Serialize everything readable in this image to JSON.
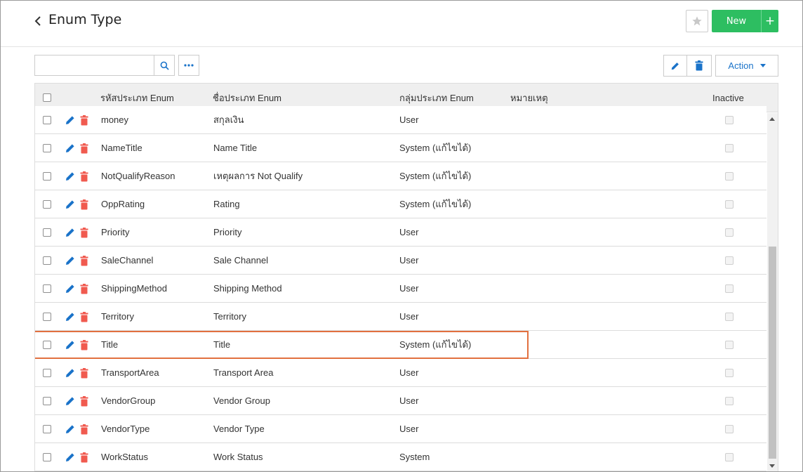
{
  "header": {
    "title": "Enum Type",
    "new_label": "New",
    "plus_label": "+"
  },
  "toolbar": {
    "search_value": "",
    "action_label": "Action"
  },
  "grid": {
    "columns": [
      "รหัสประเภท Enum",
      "ชื่อประเภท Enum",
      "กลุ่มประเภท Enum",
      "หมายเหตุ",
      "Inactive"
    ],
    "rows": [
      {
        "code": "money",
        "name": "สกุลเงิน",
        "group": "User",
        "note": ""
      },
      {
        "code": "NameTitle",
        "name": "Name Title",
        "group": "System (แก้ไขได้)",
        "note": ""
      },
      {
        "code": "NotQualifyReason",
        "name": "เหตุผลการ Not Qualify",
        "group": "System (แก้ไขได้)",
        "note": ""
      },
      {
        "code": "OppRating",
        "name": "Rating",
        "group": "System (แก้ไขได้)",
        "note": ""
      },
      {
        "code": "Priority",
        "name": "Priority",
        "group": "User",
        "note": ""
      },
      {
        "code": "SaleChannel",
        "name": "Sale Channel",
        "group": "User",
        "note": ""
      },
      {
        "code": "ShippingMethod",
        "name": "Shipping Method",
        "group": "User",
        "note": ""
      },
      {
        "code": "Territory",
        "name": "Territory",
        "group": "User",
        "note": ""
      },
      {
        "code": "Title",
        "name": "Title",
        "group": "System (แก้ไขได้)",
        "note": "",
        "highlighted": true
      },
      {
        "code": "TransportArea",
        "name": "Transport Area",
        "group": "User",
        "note": ""
      },
      {
        "code": "VendorGroup",
        "name": "Vendor Group",
        "group": "User",
        "note": ""
      },
      {
        "code": "VendorType",
        "name": "Vendor Type",
        "group": "User",
        "note": ""
      },
      {
        "code": "WorkStatus",
        "name": "Work Status",
        "group": "System",
        "note": ""
      }
    ]
  },
  "icons": {
    "back": "chevron-left-icon",
    "star": "star-icon",
    "search": "search-icon",
    "more": "ellipsis-icon",
    "edit": "pencil-icon",
    "delete": "trash-icon",
    "action_caret": "caret-down-icon"
  },
  "colors": {
    "primary_blue": "#1a73c9",
    "new_green": "#2dbe61",
    "delete_red": "#f05a4f",
    "highlight_orange": "#e2703f"
  }
}
